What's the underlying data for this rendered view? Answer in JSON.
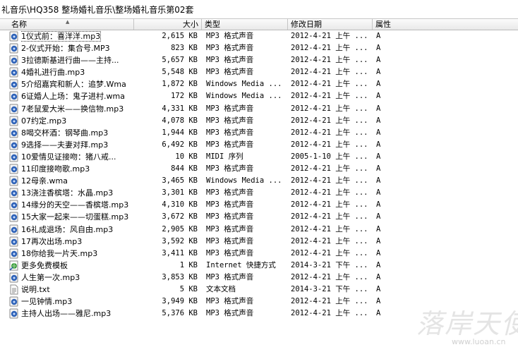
{
  "path": "礼音乐\\HQ358 整场婚礼音乐\\整场婚礼音乐第02套",
  "columns": {
    "name": "名称",
    "size": "大小",
    "type": "类型",
    "date": "修改日期",
    "attr": "属性"
  },
  "files": [
    {
      "name": "1仪式前：喜洋洋.mp3",
      "size": "2,615 KB",
      "type": "MP3 格式声音",
      "date": "2012-4-21 上午 ...",
      "attr": "A",
      "icon": "audio-file-icon"
    },
    {
      "name": "2-仪式开始：集合号.MP3",
      "size": "823 KB",
      "type": "MP3 格式声音",
      "date": "2012-4-21 上午 ...",
      "attr": "A",
      "icon": "audio-file-icon"
    },
    {
      "name": "3拉德斯基进行曲——主持...",
      "size": "5,657 KB",
      "type": "MP3 格式声音",
      "date": "2012-4-21 上午 ...",
      "attr": "A",
      "icon": "audio-file-icon"
    },
    {
      "name": "4婚礼进行曲.mp3",
      "size": "5,548 KB",
      "type": "MP3 格式声音",
      "date": "2012-4-21 上午 ...",
      "attr": "A",
      "icon": "audio-file-icon"
    },
    {
      "name": "5介绍嘉宾和新人：追梦.Wma",
      "size": "1,872 KB",
      "type": "Windows Media ...",
      "date": "2012-4-21 上午 ...",
      "attr": "A",
      "icon": "audio-file-icon"
    },
    {
      "name": "6证婚人上场：鬼子进村.wma",
      "size": "172 KB",
      "type": "Windows Media ...",
      "date": "2012-4-21 上午 ...",
      "attr": "A",
      "icon": "audio-file-icon"
    },
    {
      "name": "7老鼠爱大米——换信物.mp3",
      "size": "4,331 KB",
      "type": "MP3 格式声音",
      "date": "2012-4-21 上午 ...",
      "attr": "A",
      "icon": "audio-file-icon"
    },
    {
      "name": "07约定.mp3",
      "size": "4,078 KB",
      "type": "MP3 格式声音",
      "date": "2012-4-21 上午 ...",
      "attr": "A",
      "icon": "audio-file-icon"
    },
    {
      "name": "8喝交杯酒：钢琴曲.mp3",
      "size": "1,944 KB",
      "type": "MP3 格式声音",
      "date": "2012-4-21 上午 ...",
      "attr": "A",
      "icon": "audio-file-icon"
    },
    {
      "name": "9选择——夫妻对拜.mp3",
      "size": "6,492 KB",
      "type": "MP3 格式声音",
      "date": "2012-4-21 上午 ...",
      "attr": "A",
      "icon": "audio-file-icon"
    },
    {
      "name": "10爱情见证接吻：猪八戒...",
      "size": "10 KB",
      "type": "MIDI 序列",
      "date": "2005-1-10 上午 ...",
      "attr": "A",
      "icon": "audio-file-icon"
    },
    {
      "name": "11印度接吻歌.mp3",
      "size": "844 KB",
      "type": "MP3 格式声音",
      "date": "2012-4-21 上午 ...",
      "attr": "A",
      "icon": "audio-file-icon"
    },
    {
      "name": "12母亲.wma",
      "size": "3,465 KB",
      "type": "Windows Media ...",
      "date": "2012-4-21 上午 ...",
      "attr": "A",
      "icon": "audio-file-icon"
    },
    {
      "name": "13浇注香槟塔：水晶.mp3",
      "size": "3,301 KB",
      "type": "MP3 格式声音",
      "date": "2012-4-21 上午 ...",
      "attr": "A",
      "icon": "audio-file-icon"
    },
    {
      "name": "14缘分的天空——香槟塔.mp3",
      "size": "4,310 KB",
      "type": "MP3 格式声音",
      "date": "2012-4-21 上午 ...",
      "attr": "A",
      "icon": "audio-file-icon"
    },
    {
      "name": "15大家一起来——切蛋糕.mp3",
      "size": "3,672 KB",
      "type": "MP3 格式声音",
      "date": "2012-4-21 上午 ...",
      "attr": "A",
      "icon": "audio-file-icon"
    },
    {
      "name": "16礼成退场：风自由.mp3",
      "size": "2,905 KB",
      "type": "MP3 格式声音",
      "date": "2012-4-21 上午 ...",
      "attr": "A",
      "icon": "audio-file-icon"
    },
    {
      "name": "17再次出场.mp3",
      "size": "3,592 KB",
      "type": "MP3 格式声音",
      "date": "2012-4-21 上午 ...",
      "attr": "A",
      "icon": "audio-file-icon"
    },
    {
      "name": "18你给我一片天.mp3",
      "size": "3,411 KB",
      "type": "MP3 格式声音",
      "date": "2012-4-21 上午 ...",
      "attr": "A",
      "icon": "audio-file-icon"
    },
    {
      "name": "更多免费模板",
      "size": "1 KB",
      "type": "Internet 快捷方式",
      "date": "2014-3-21 下午 ...",
      "attr": "A",
      "icon": "internet-shortcut-icon"
    },
    {
      "name": "人生第一次.mp3",
      "size": "3,853 KB",
      "type": "MP3 格式声音",
      "date": "2012-4-21 上午 ...",
      "attr": "A",
      "icon": "audio-file-icon"
    },
    {
      "name": "说明.txt",
      "size": "5 KB",
      "type": "文本文档",
      "date": "2014-3-21 下午 ...",
      "attr": "A",
      "icon": "text-file-icon"
    },
    {
      "name": "一见钟情.mp3",
      "size": "3,949 KB",
      "type": "MP3 格式声音",
      "date": "2012-4-21 上午 ...",
      "attr": "A",
      "icon": "audio-file-icon"
    },
    {
      "name": "主持人出场——雅尼.mp3",
      "size": "5,376 KB",
      "type": "MP3 格式声音",
      "date": "2012-4-21 上午 ...",
      "attr": "A",
      "icon": "audio-file-icon"
    }
  ],
  "selected_index": 0,
  "watermark": {
    "text": "落岸天使",
    "url": "www.luoan.cn"
  }
}
